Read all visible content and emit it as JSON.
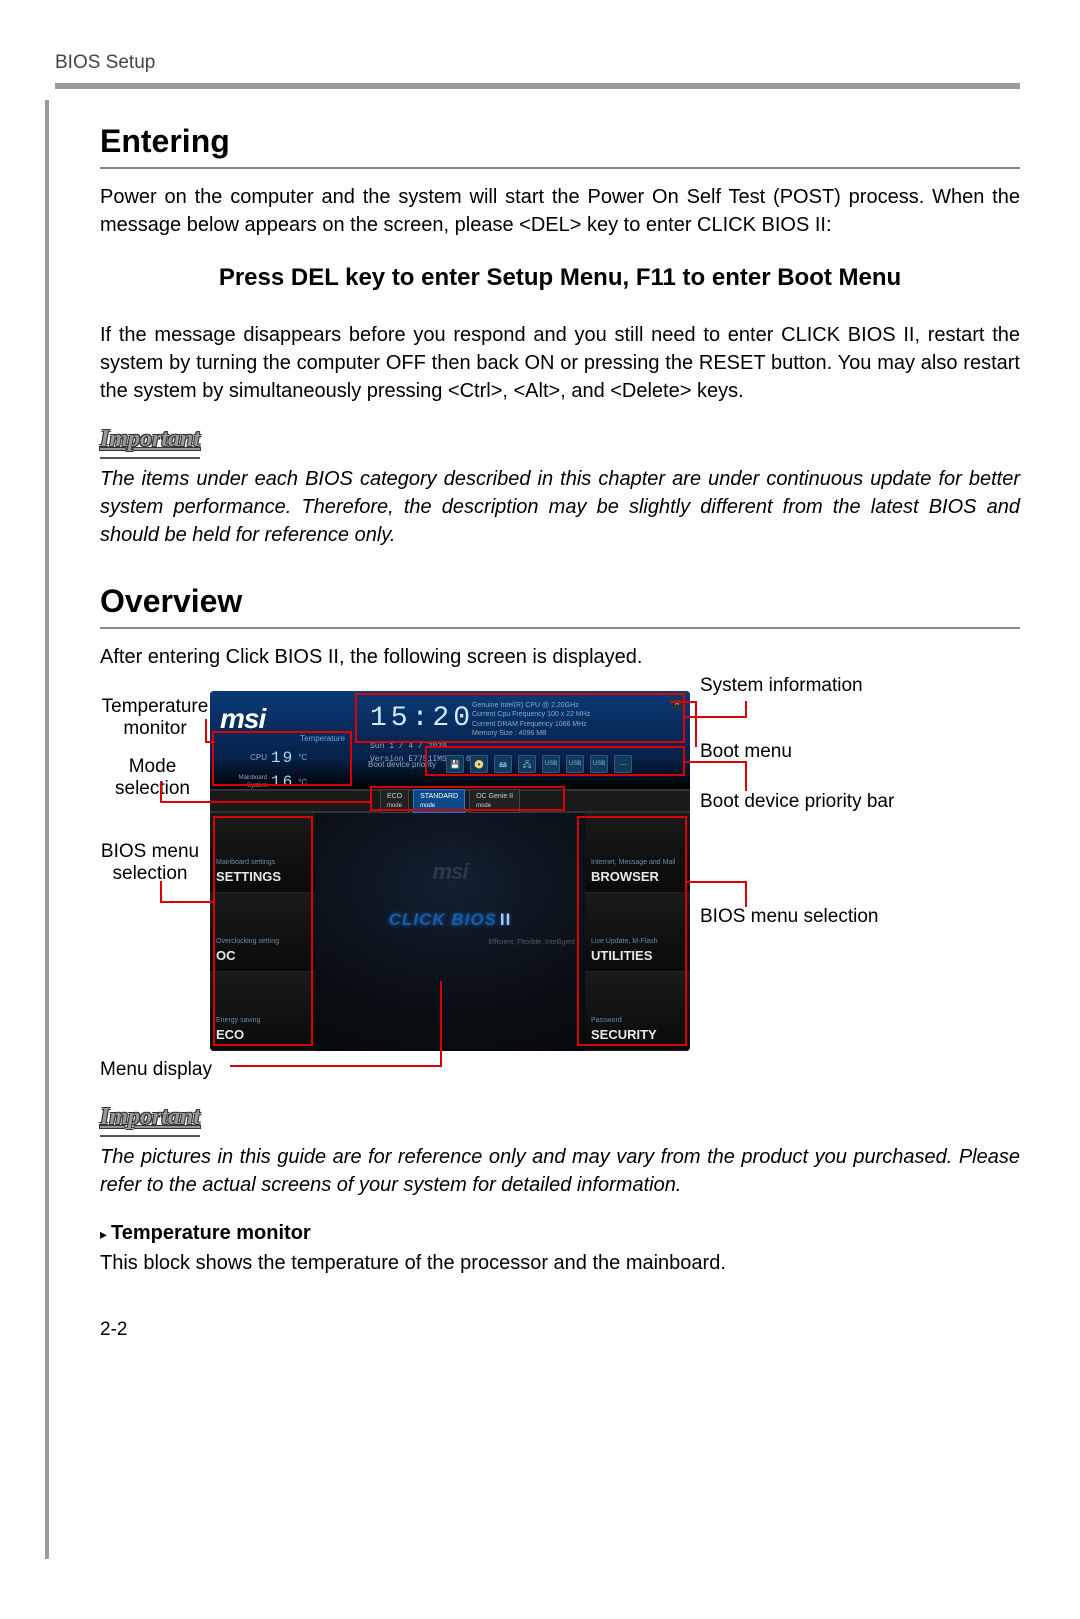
{
  "header": {
    "label": "BIOS Setup"
  },
  "entering": {
    "title": "Entering",
    "p1": "Power on the computer and the system will start the Power On Self Test (POST) process. When the message below appears on the screen, please <DEL> key to enter CLICK BIOS II:",
    "press": "Press DEL key to enter Setup Menu, F11 to enter Boot Menu",
    "p2": "If the message disappears before you respond and you still need to enter CLICK BIOS II, restart the system by turning the computer OFF then back ON or pressing the RESET button. You may also restart the system by simultaneously pressing <Ctrl>, <Alt>, and <Delete> keys."
  },
  "important1": {
    "label": "Important",
    "text": "The items under each BIOS category described in this chapter are under continuous update for better system performance. Therefore, the description may be slightly different from the latest BIOS and should be held for reference only."
  },
  "overview": {
    "title": "Overview",
    "intro": "After entering Click BIOS II, the following screen is displayed."
  },
  "figure": {
    "labels": {
      "temp": "Temperature monitor",
      "mode": "Mode selection",
      "biosleft": "BIOS menu selection",
      "menudisp": "Menu display",
      "sysinfo": "System information",
      "bootmenu": "Boot menu",
      "bootprio": "Boot device priority bar",
      "biosright": "BIOS menu selection"
    },
    "bios": {
      "logo": "msi",
      "temp_label": "Temperature",
      "cpu_name": "CPU",
      "cpu_val": "19",
      "deg": "°C",
      "mb_name": "Mainboard System",
      "mb_val": "16",
      "clock": "15:20",
      "date1": "Sun  1 / 4 / 2029",
      "date2": "Version E7751IMS V1.0B15",
      "sys1": "Genuine Intel(R) CPU @ 2.20GHz",
      "sys2": "Current Cpu Frequency 100 x 22 MHz",
      "sys3": "Current DRAM Frequency 1066 MHz",
      "sys4": "Memory Size : 4096 MB",
      "boot_label": "Boot device priority",
      "modes": {
        "eco": "ECO mode",
        "std": "STANDARD mode",
        "oc": "OC Genie II mode"
      },
      "left": [
        {
          "t1": "Mainboard settings",
          "t2": "SETTINGS"
        },
        {
          "t1": "Overclocking setting",
          "t2": "OC"
        },
        {
          "t1": "Energy saving",
          "t2": "ECO"
        }
      ],
      "right": [
        {
          "t1": "Internet, Message and Mail",
          "t2": "BROWSER"
        },
        {
          "t1": "Live Update, M-Flash",
          "t2": "UTILITIES"
        },
        {
          "t1": "Password",
          "t2": "SECURITY"
        }
      ],
      "center_title": "CLICK BIOS",
      "center_suffix": "II",
      "tagline": "Efficient, Flexible, Intelligent"
    }
  },
  "important2": {
    "label": "Important",
    "text": "The pictures in this guide are for reference only and may vary from the product you purchased. Please refer to the actual screens of your system for detailed information."
  },
  "tempmon": {
    "title": "Temperature monitor",
    "text": "This block shows the temperature of  the processor and the mainboard."
  },
  "page": "2-2"
}
